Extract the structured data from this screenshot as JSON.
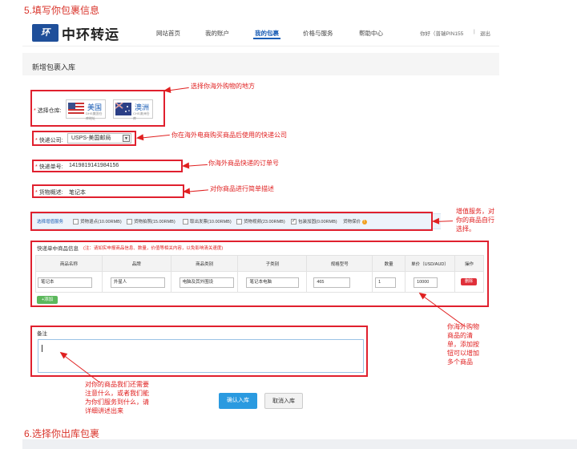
{
  "step5_title": "5.填写你包裹信息",
  "step6_title": "6.选择你出库包裹",
  "header": {
    "logo_mark": "环CHS",
    "brand_name": "中环转运",
    "nav": [
      "网站首页",
      "我的账户",
      "我的包裹",
      "价格与服务",
      "帮助中心"
    ],
    "active_nav": "我的包裹",
    "greeting": "你好（普瑞PIN155",
    "divider": "|",
    "logout": "退出"
  },
  "form": {
    "title": "新增包裹入库",
    "warehouse_label": "选择仓库:",
    "warehouses": [
      {
        "name": "美国",
        "sub": "DHS美国仓库地址"
      },
      {
        "name": "澳洲",
        "sub": "CHS澳洲仓库"
      }
    ],
    "courier_label": "快递公司:",
    "courier_value": "USPS-美国邮局",
    "tracking_label": "快递单号:",
    "tracking_value": "141981914198415​6",
    "goods_label": "货物概述:",
    "goods_value": "笔记本",
    "services_title": "选择增值服务",
    "services": [
      {
        "label": "货物退点(10.00RMB)",
        "checked": false
      },
      {
        "label": "货物拍照(15.00RMB)",
        "checked": false
      },
      {
        "label": "取出发票(10.00RMB)",
        "checked": false
      },
      {
        "label": "货物视频(23.00RMB)",
        "checked": false
      },
      {
        "label": "包装加固(0.00RMB)",
        "checked": true
      },
      {
        "label": "货物保价",
        "checked": false
      }
    ],
    "items_title": "快递单中商品信息",
    "items_hint": "(注：请如实申报商品信息、数量，价值等相关内容，以免影响清关速度)",
    "columns": [
      "商品名称",
      "品牌",
      "商品类别",
      "子类别",
      "规格型号",
      "数量",
      "单价（USD/AUD）",
      "操作"
    ],
    "row": {
      "name": "笔记本",
      "brand": "外星人",
      "category": "电脑及其外围设",
      "subcategory": "笔记本电脑",
      "model": "465",
      "qty": "1",
      "price": "10000",
      "delete": "删除"
    },
    "add_button": "+添加",
    "remarks_label": "备注",
    "confirm_button": "确认入库",
    "cancel_button": "取消入库"
  },
  "annotations": {
    "warehouse": "选择你海外购物的地方",
    "courier": "你在海外电商购买商品后使用的快递公司",
    "tracking": "你海外商品快递的订单号",
    "goods": "对你商品进行简单描述",
    "services": [
      "增值服务，对",
      "你的商品自行",
      "选择。"
    ],
    "items": [
      "你海外购物",
      "商品的清",
      "单，添加按",
      "钮可以增加",
      "多个商品"
    ],
    "remarks": [
      "对你的商品我们还需要",
      "注意什么，或者我们能",
      "为你们服务到什么，请",
      "详细讲述出来"
    ]
  },
  "colors": {
    "annotation_red": "#e02020",
    "brand_blue": "#1a5db5",
    "confirm_blue": "#2a9ae0"
  }
}
